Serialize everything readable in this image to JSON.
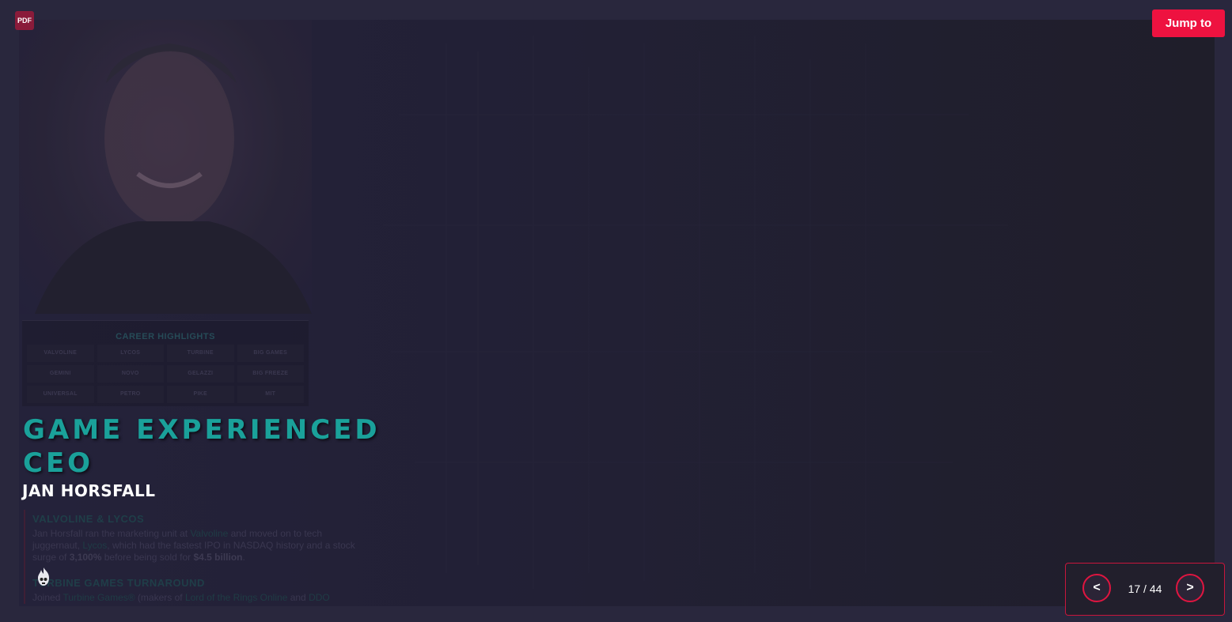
{
  "toolbar": {
    "pdf_label": "PDF",
    "jump_label": "Jump to"
  },
  "slide": {
    "career": {
      "title": "CAREER HIGHLIGHTS",
      "items": [
        "VALVOLINE",
        "LYCOS",
        "TURBINE",
        "BIG GAMES",
        "GEMINI",
        "NOVO",
        "GELAZZI",
        "BIG FREEZE",
        "UNIVERSAL",
        "PETRO",
        "PIKE",
        "MIT"
      ]
    },
    "headline": "GAME EXPERIENCED CEO",
    "person_name": "JAN HORSFALL",
    "bio": {
      "section1_title": "VALVOLINE & LYCOS",
      "s1_text_a": "Jan Horsfall ran the marketing unit at ",
      "s1_valvoline": "Valvoline",
      "s1_text_b": " and moved on to tech juggernaut, ",
      "s1_lycos": "Lycos",
      "s1_text_c": ", which had the fastest IPO in NASDAQ history and a stock surge of ",
      "s1_surge": "3,100%",
      "s1_text_d": " before being sold for ",
      "s1_price": "$4.5 billion",
      "s1_text_e": ".",
      "section2_title": "TURBINE GAMES TURNAROUND",
      "s2_text_a": "Joined ",
      "s2_turbine": "Turbine Games®",
      "s2_text_b": " (makers of ",
      "s2_lotro": "Lord of the Rings Online",
      "s2_text_c": " and ",
      "s2_ddo": "DDO"
    }
  },
  "pager": {
    "prev_label": "<",
    "next_label": ">",
    "current": "17",
    "total": "44",
    "indicator": "17 / 44"
  },
  "colors": {
    "accent": "#ee1240",
    "headline": "#1aa19a",
    "background": "#29273d"
  }
}
